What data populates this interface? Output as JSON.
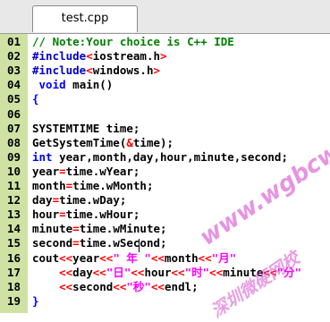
{
  "tab": {
    "label": "test.cpp"
  },
  "colors": {
    "gutter": "#cfe2a4",
    "comment": "#008000",
    "preprocessor": "#0000cc",
    "keyword": "#0000ff",
    "string": "#ff00ff",
    "operator": "#ff0000",
    "plain": "#000000",
    "watermark": "#d23cc8"
  },
  "lines": [
    {
      "n": "01",
      "tokens": [
        {
          "t": "// Note:Your choice is C++ IDE",
          "c": "comment"
        }
      ]
    },
    {
      "n": "02",
      "tokens": [
        {
          "t": "#include",
          "c": "preprocessor"
        },
        {
          "t": "<",
          "c": "operator"
        },
        {
          "t": "iostream.h",
          "c": "plain"
        },
        {
          "t": ">",
          "c": "operator"
        }
      ]
    },
    {
      "n": "03",
      "tokens": [
        {
          "t": "#include",
          "c": "preprocessor"
        },
        {
          "t": "<",
          "c": "operator"
        },
        {
          "t": "windows.h",
          "c": "plain"
        },
        {
          "t": ">",
          "c": "operator"
        }
      ]
    },
    {
      "n": "04",
      "tokens": [
        {
          "t": " void",
          "c": "keyword"
        },
        {
          "t": " main()",
          "c": "plain"
        }
      ]
    },
    {
      "n": "05",
      "tokens": [
        {
          "t": "{",
          "c": "keyword"
        }
      ]
    },
    {
      "n": "06",
      "tokens": []
    },
    {
      "n": "07",
      "tokens": [
        {
          "t": "SYSTEMTIME time;",
          "c": "plain"
        }
      ]
    },
    {
      "n": "08",
      "tokens": [
        {
          "t": "GetSystemTime(",
          "c": "plain"
        },
        {
          "t": "&",
          "c": "operator"
        },
        {
          "t": "time);",
          "c": "plain"
        }
      ]
    },
    {
      "n": "09",
      "tokens": [
        {
          "t": "int",
          "c": "keyword"
        },
        {
          "t": " year,month,day,hour,minute,second;",
          "c": "plain"
        }
      ]
    },
    {
      "n": "10",
      "tokens": [
        {
          "t": "year",
          "c": "plain"
        },
        {
          "t": "=",
          "c": "operator"
        },
        {
          "t": "time.wYear;",
          "c": "plain"
        }
      ]
    },
    {
      "n": "11",
      "tokens": [
        {
          "t": "month",
          "c": "plain"
        },
        {
          "t": "=",
          "c": "operator"
        },
        {
          "t": "time.wMonth;",
          "c": "plain"
        }
      ]
    },
    {
      "n": "12",
      "tokens": [
        {
          "t": "day",
          "c": "plain"
        },
        {
          "t": "=",
          "c": "operator"
        },
        {
          "t": "time.wDay;",
          "c": "plain"
        }
      ]
    },
    {
      "n": "13",
      "tokens": [
        {
          "t": "hour",
          "c": "plain"
        },
        {
          "t": "=",
          "c": "operator"
        },
        {
          "t": "time.wHour;",
          "c": "plain"
        }
      ]
    },
    {
      "n": "14",
      "tokens": [
        {
          "t": "minute",
          "c": "plain"
        },
        {
          "t": "=",
          "c": "operator"
        },
        {
          "t": "time.wMinute;",
          "c": "plain"
        }
      ]
    },
    {
      "n": "15",
      "tokens": [
        {
          "t": "second",
          "c": "plain"
        },
        {
          "t": "=",
          "c": "operator"
        },
        {
          "t": "time.wSecond;",
          "c": "plain"
        }
      ]
    },
    {
      "n": "16",
      "tokens": [
        {
          "t": "cout",
          "c": "plain"
        },
        {
          "t": "<<",
          "c": "operator"
        },
        {
          "t": "year",
          "c": "plain"
        },
        {
          "t": "<<",
          "c": "operator"
        },
        {
          "t": "\" 年 \"",
          "c": "string"
        },
        {
          "t": "<<",
          "c": "operator"
        },
        {
          "t": "month",
          "c": "plain"
        },
        {
          "t": "<<",
          "c": "operator"
        },
        {
          "t": "\"月\"",
          "c": "string"
        }
      ]
    },
    {
      "n": "17",
      "tokens": [
        {
          "t": "    ",
          "c": "plain"
        },
        {
          "t": "<<",
          "c": "operator"
        },
        {
          "t": "day",
          "c": "plain"
        },
        {
          "t": "<<",
          "c": "operator"
        },
        {
          "t": "\"日\"",
          "c": "string"
        },
        {
          "t": "<<",
          "c": "operator"
        },
        {
          "t": "hour",
          "c": "plain"
        },
        {
          "t": "<<",
          "c": "operator"
        },
        {
          "t": "\"时\"",
          "c": "string"
        },
        {
          "t": "<<",
          "c": "operator"
        },
        {
          "t": "minute",
          "c": "plain"
        },
        {
          "t": "<<",
          "c": "operator"
        },
        {
          "t": "\"分\"",
          "c": "string"
        }
      ]
    },
    {
      "n": "18",
      "tokens": [
        {
          "t": "    ",
          "c": "plain"
        },
        {
          "t": "<<",
          "c": "operator"
        },
        {
          "t": "second",
          "c": "plain"
        },
        {
          "t": "<<",
          "c": "operator"
        },
        {
          "t": "\"秒\"",
          "c": "string"
        },
        {
          "t": "<<",
          "c": "operator"
        },
        {
          "t": "endl;",
          "c": "plain"
        }
      ]
    },
    {
      "n": "19",
      "tokens": [
        {
          "t": "}",
          "c": "keyword"
        }
      ]
    }
  ],
  "watermark": {
    "url": "www.wgbcw.com",
    "chinese": "深圳微硬网校"
  }
}
